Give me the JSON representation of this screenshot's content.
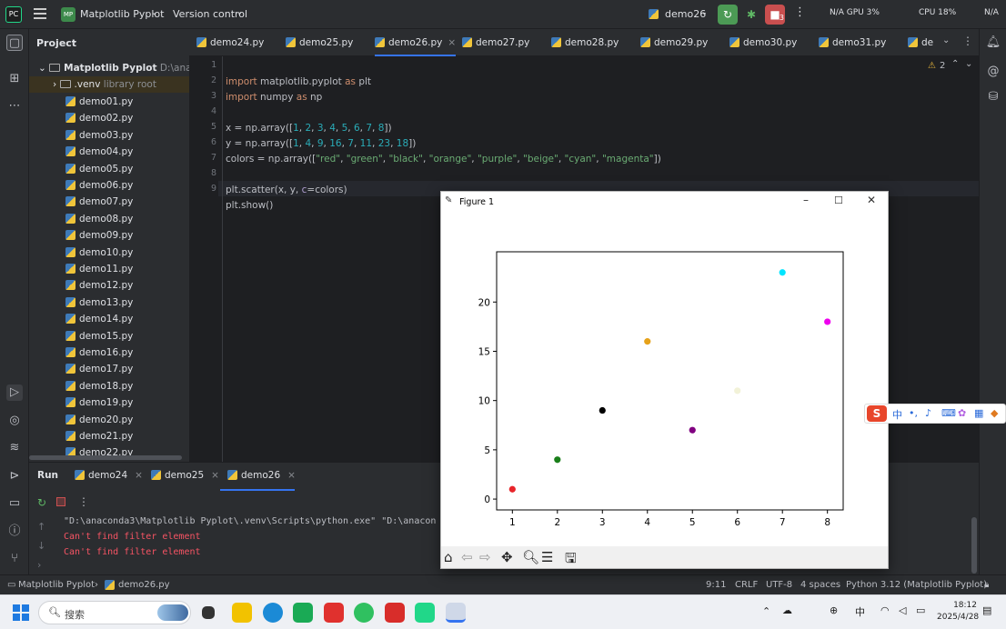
{
  "titlebar": {
    "project_badge": "MP",
    "project_name": "Matplotlib Pyplot",
    "version_control": "Version control",
    "run_config": "demo26",
    "stop_badge": "3",
    "gpu_stats": "N/A  GPU 3%",
    "cpu_stats": "CPU 18%",
    "mem_stats": "N/A"
  },
  "project_panel": {
    "title": "Project",
    "root": "Matplotlib Pyplot",
    "root_path": "D:\\anaconda",
    "venv": ".venv",
    "venv_note": "library root",
    "files": [
      "demo01.py",
      "demo02.py",
      "demo03.py",
      "demo04.py",
      "demo05.py",
      "demo06.py",
      "demo07.py",
      "demo08.py",
      "demo09.py",
      "demo10.py",
      "demo11.py",
      "demo12.py",
      "demo13.py",
      "demo14.py",
      "demo15.py",
      "demo16.py",
      "demo17.py",
      "demo18.py",
      "demo19.py",
      "demo20.py",
      "demo21.py",
      "demo22.py"
    ]
  },
  "editor_tabs": [
    "demo24.py",
    "demo25.py",
    "demo26.py",
    "demo27.py",
    "demo28.py",
    "demo29.py",
    "demo30.py",
    "demo31.py",
    "de"
  ],
  "editor": {
    "warnings": "2",
    "line_numbers": [
      "1",
      "2",
      "3",
      "4",
      "5",
      "6",
      "7",
      "8",
      "9"
    ],
    "lines": [
      "import matplotlib.pyplot as plt",
      "import numpy as np",
      "",
      "x = np.array([1, 2, 3, 4, 5, 6, 7, 8])",
      "y = np.array([1, 4, 9, 16, 7, 11, 23, 18])",
      "colors = np.array([\"red\", \"green\", \"black\", \"orange\", \"purple\", \"beige\", \"cyan\", \"magenta\"])",
      "",
      "plt.scatter(x, y, c=colors)",
      "plt.show()"
    ]
  },
  "run_panel": {
    "label": "Run",
    "tabs": [
      "demo24",
      "demo25",
      "demo26"
    ],
    "output": [
      "\"D:\\anaconda3\\Matplotlib Pyplot\\.venv\\Scripts\\python.exe\" \"D:\\anacon",
      "Can't find filter element",
      "Can't find filter element"
    ]
  },
  "status_bar": {
    "breadcrumb_project": "Matplotlib Pyplot",
    "breadcrumb_file": "demo26.py",
    "position": "9:11",
    "line_sep": "CRLF",
    "encoding": "UTF-8",
    "indent": "4 spaces",
    "interpreter": "Python 3.12 (Matplotlib Pyplot)"
  },
  "figure_window": {
    "title": "Figure 1"
  },
  "chart_data": {
    "type": "scatter",
    "x": [
      1,
      2,
      3,
      4,
      5,
      6,
      7,
      8
    ],
    "y": [
      1,
      4,
      9,
      16,
      7,
      11,
      23,
      18
    ],
    "colors": [
      "#e8242a",
      "#1a7f1a",
      "#000000",
      "#e6a21a",
      "#800080",
      "#f2f2d8",
      "#00e5ff",
      "#ee00ee"
    ],
    "xticks": [
      1,
      2,
      3,
      4,
      5,
      6,
      7,
      8
    ],
    "yticks": [
      0,
      5,
      10,
      15,
      20
    ],
    "xlim": [
      0.65,
      8.35
    ],
    "ylim": [
      -1.1,
      25.1
    ],
    "title": "",
    "xlabel": "",
    "ylabel": ""
  },
  "ime": {
    "lang": "中"
  },
  "taskbar": {
    "search_placeholder": "搜索",
    "time": "18:12",
    "date": "2025/4/28"
  }
}
